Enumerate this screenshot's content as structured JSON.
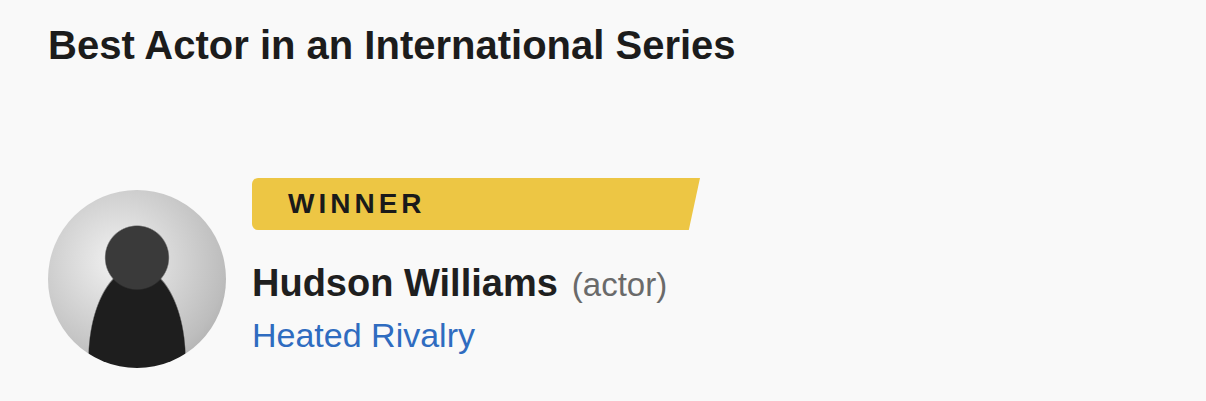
{
  "category": {
    "title": "Best Actor in an International Series"
  },
  "nominee": {
    "badge": "WINNER",
    "winner": true,
    "name": "Hudson Williams",
    "role": "(actor)",
    "show": "Heated Rivalry"
  }
}
